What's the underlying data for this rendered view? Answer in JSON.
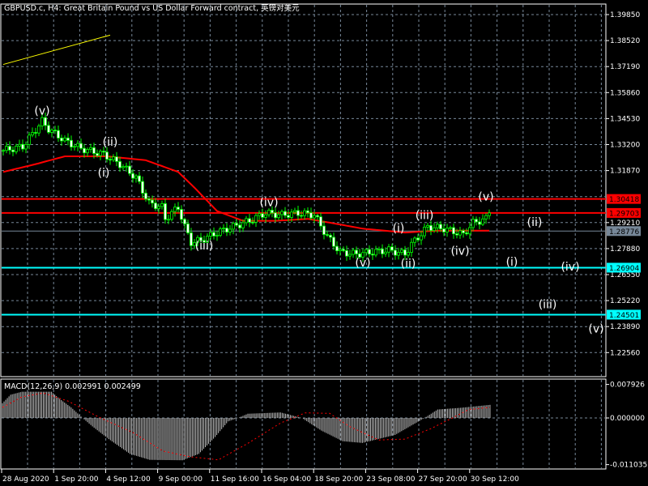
{
  "header": {
    "title": "GBPUSD.c, H4:  Great Britain Pound vs US Dollar Forward contract, 英镑对美元"
  },
  "colors": {
    "background": "#000000",
    "grid": "#778899",
    "candle": "#00ff00",
    "ma": "#ff0000",
    "support": "#00ffff",
    "resistance": "#ff0000",
    "current": "#778899",
    "trendline": "#ffff00",
    "macd_hist": "#c0c0c0",
    "macd_signal": "#ff0000"
  },
  "price_axis": {
    "labels": [
      "1.39850",
      "1.38520",
      "1.37190",
      "1.35860",
      "1.34530",
      "1.33200",
      "1.31870",
      "1.29210",
      "1.27880",
      "1.26550",
      "1.25220",
      "1.23890",
      "1.22560"
    ],
    "values": [
      1.3985,
      1.3852,
      1.3719,
      1.3586,
      1.3453,
      1.332,
      1.3187,
      1.2921,
      1.2788,
      1.2655,
      1.2522,
      1.2389,
      1.2256
    ]
  },
  "levels": [
    {
      "label": "1.30418",
      "value": 1.30418,
      "kind": "resistance"
    },
    {
      "label": "1.29703",
      "value": 1.29703,
      "kind": "resistance"
    },
    {
      "label": "1.28776",
      "value": 1.28776,
      "kind": "current"
    },
    {
      "label": "1.26904",
      "value": 1.26904,
      "kind": "support"
    },
    {
      "label": "1.24501",
      "value": 1.24501,
      "kind": "support"
    }
  ],
  "wave_labels": [
    {
      "text": "(v)",
      "bar": 12,
      "price": 1.3495
    },
    {
      "text": "(ii)",
      "bar": 33,
      "price": 1.3335
    },
    {
      "text": "(i)",
      "bar": 31,
      "price": 1.3178
    },
    {
      "text": "(iii)",
      "bar": 62,
      "price": 1.2805
    },
    {
      "text": "(iv)",
      "bar": 82,
      "price": 1.3025
    },
    {
      "text": "(v)",
      "bar": 111,
      "price": 1.2717
    },
    {
      "text": "(ii)",
      "bar": 125,
      "price": 1.2712
    },
    {
      "text": "(i)",
      "bar": 122,
      "price": 1.2893
    },
    {
      "text": "(iii)",
      "bar": 130,
      "price": 1.2959
    },
    {
      "text": "(iv)",
      "bar": 141,
      "price": 1.2778
    },
    {
      "text": "(v)",
      "bar": 149,
      "price": 1.3054
    },
    {
      "text": "(ii)",
      "bar": 164,
      "price": 1.2925
    },
    {
      "text": "(i)",
      "bar": 157,
      "price": 1.2722
    },
    {
      "text": "(iv)",
      "bar": 175,
      "price": 1.2697
    },
    {
      "text": "(iii)",
      "bar": 168,
      "price": 1.2503
    },
    {
      "text": "(v)",
      "bar": 183,
      "price": 1.238
    }
  ],
  "time_axis": [
    "28 Aug 2020",
    "1 Sep 20:00",
    "4 Sep 12:00",
    "9 Sep 00:00",
    "11 Sep 16:00",
    "16 Sep 04:00",
    "18 Sep 20:00",
    "23 Sep 08:00",
    "27 Sep 20:00",
    "30 Sep 12:00"
  ],
  "macd": {
    "label": "MACD(12,26,9) 0.002991 0.002499",
    "axis_labels": [
      "0.007926",
      "0.000000",
      "-0.011035"
    ],
    "axis_values": [
      0.007926,
      0,
      -0.011035
    ]
  },
  "chart_data": {
    "type": "candlestick",
    "symbol": "GBPUSD.c",
    "timeframe": "H4",
    "ylim": [
      1.22,
      1.402
    ],
    "close_keypoints": [
      [
        0,
        1.329
      ],
      [
        6,
        1.331
      ],
      [
        12,
        1.344
      ],
      [
        14,
        1.34
      ],
      [
        19,
        1.334
      ],
      [
        24,
        1.33
      ],
      [
        31,
        1.327
      ],
      [
        36,
        1.322
      ],
      [
        41,
        1.315
      ],
      [
        45,
        1.302
      ],
      [
        49,
        1.3
      ],
      [
        50,
        1.294
      ],
      [
        54,
        1.3
      ],
      [
        56,
        1.29
      ],
      [
        58,
        1.282
      ],
      [
        61,
        1.283
      ],
      [
        66,
        1.287
      ],
      [
        71,
        1.29
      ],
      [
        76,
        1.293
      ],
      [
        81,
        1.297
      ],
      [
        86,
        1.296
      ],
      [
        91,
        1.297
      ],
      [
        96,
        1.296
      ],
      [
        100,
        1.285
      ],
      [
        104,
        1.277
      ],
      [
        109,
        1.276
      ],
      [
        114,
        1.277
      ],
      [
        119,
        1.278
      ],
      [
        124,
        1.276
      ],
      [
        126,
        1.281
      ],
      [
        131,
        1.29
      ],
      [
        136,
        1.289
      ],
      [
        142,
        1.286
      ],
      [
        145,
        1.292
      ],
      [
        149,
        1.294
      ],
      [
        150,
        1.29703
      ]
    ],
    "ma_keypoints": [
      [
        0,
        1.318
      ],
      [
        10,
        1.322
      ],
      [
        19,
        1.326
      ],
      [
        32,
        1.326
      ],
      [
        44,
        1.324
      ],
      [
        54,
        1.318
      ],
      [
        59,
        1.31
      ],
      [
        66,
        1.298
      ],
      [
        74,
        1.293
      ],
      [
        84,
        1.293
      ],
      [
        94,
        1.294
      ],
      [
        101,
        1.292
      ],
      [
        111,
        1.289
      ],
      [
        124,
        1.287
      ],
      [
        134,
        1.288
      ],
      [
        150,
        1.288
      ]
    ],
    "trendline": [
      [
        0,
        1.373
      ],
      [
        33,
        1.388
      ]
    ],
    "macd_hist_keypoints": [
      [
        0,
        0.0035
      ],
      [
        5,
        0.0055
      ],
      [
        12,
        0.0062
      ],
      [
        30,
        0.0062
      ],
      [
        35,
        0.0045
      ],
      [
        42,
        0.0025
      ],
      [
        49,
        0.0
      ],
      [
        55,
        -0.002
      ],
      [
        65,
        -0.005
      ],
      [
        78,
        -0.0085
      ],
      [
        90,
        -0.0099
      ],
      [
        110,
        -0.01
      ],
      [
        120,
        -0.0085
      ],
      [
        130,
        -0.0045
      ],
      [
        138,
        -0.0008
      ],
      [
        144,
        0.0
      ],
      [
        150,
        0.001
      ],
      [
        170,
        0.0013
      ],
      [
        183,
        0.0
      ],
      [
        195,
        -0.003
      ],
      [
        208,
        -0.0055
      ],
      [
        220,
        -0.0059
      ],
      [
        240,
        -0.004
      ],
      [
        258,
        0.0
      ],
      [
        266,
        0.002
      ],
      [
        280,
        0.0024
      ],
      [
        298,
        0.0031
      ]
    ],
    "macd_signal_keypoints": [
      [
        0,
        0.0025
      ],
      [
        12,
        0.005
      ],
      [
        25,
        0.0059
      ],
      [
        40,
        0.004
      ],
      [
        60,
        0.0
      ],
      [
        80,
        -0.0035
      ],
      [
        98,
        -0.0078
      ],
      [
        115,
        -0.0092
      ],
      [
        132,
        -0.0099
      ],
      [
        150,
        -0.006
      ],
      [
        170,
        -0.0012
      ],
      [
        185,
        0.0012
      ],
      [
        200,
        0.0011
      ],
      [
        212,
        -0.002
      ],
      [
        230,
        -0.0052
      ],
      [
        246,
        -0.005
      ],
      [
        262,
        -0.0025
      ],
      [
        275,
        0.0
      ],
      [
        285,
        0.002
      ],
      [
        298,
        0.0025
      ]
    ]
  }
}
